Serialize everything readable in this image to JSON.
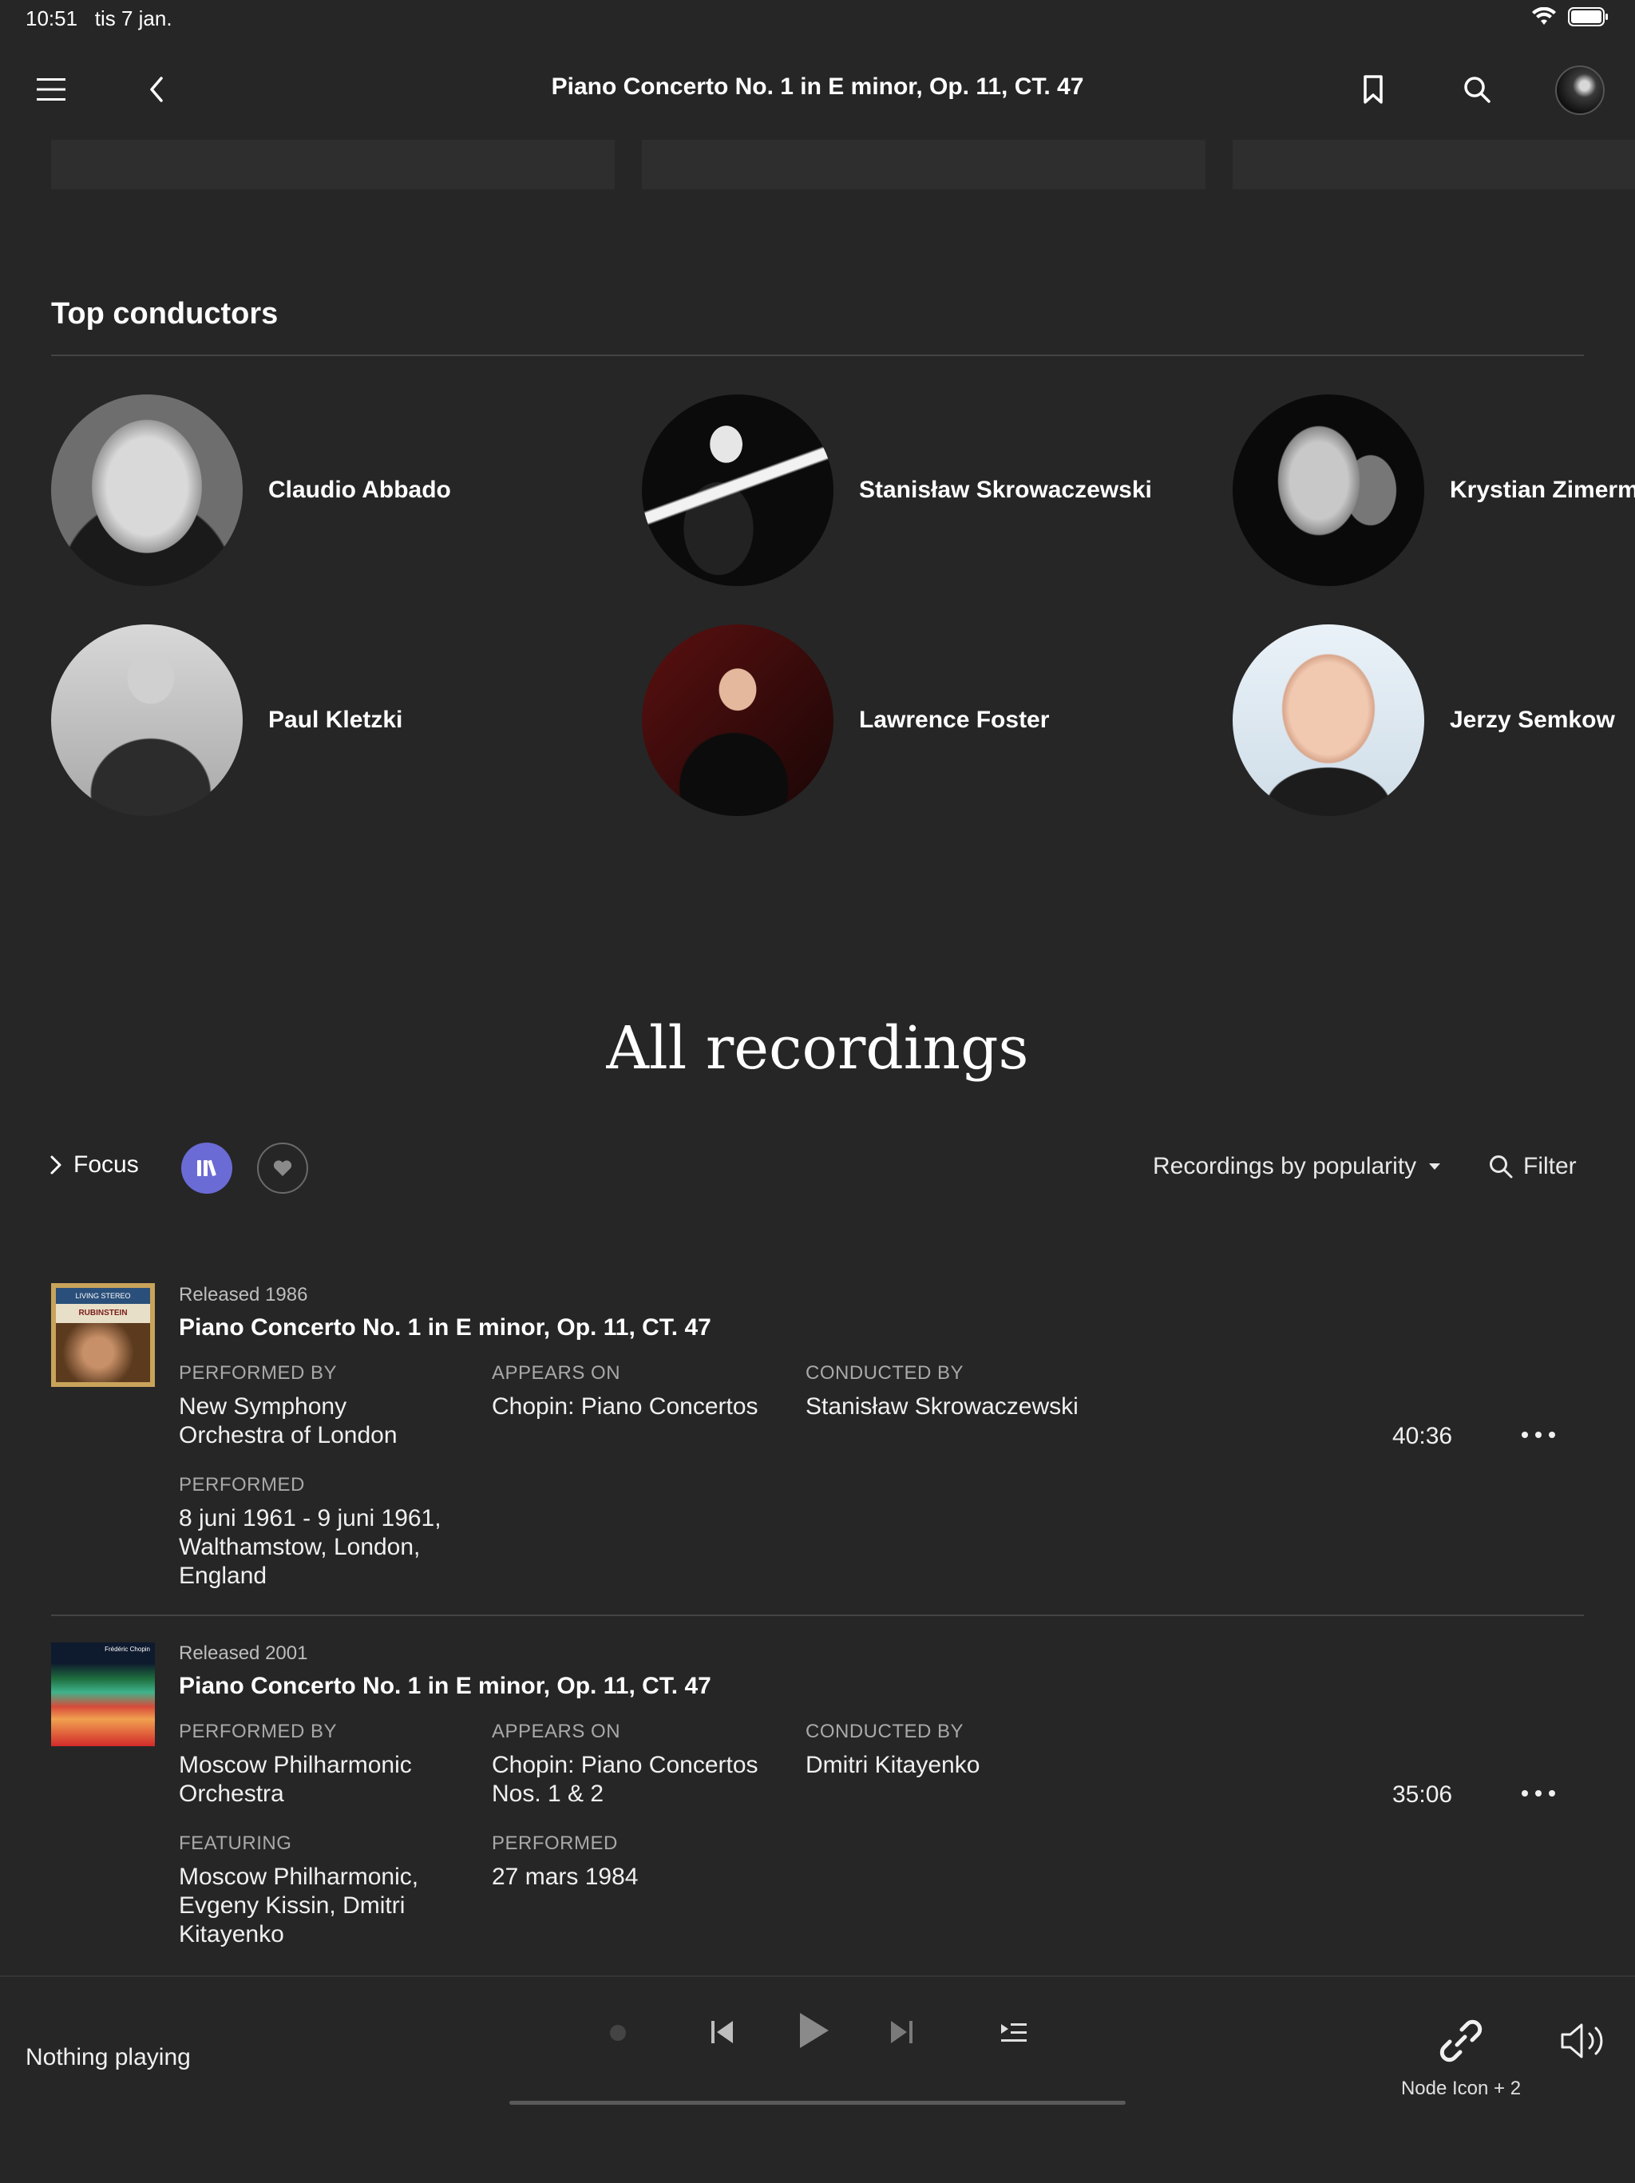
{
  "status_bar": {
    "time": "10:51",
    "date": "tis 7 jan."
  },
  "nav": {
    "title": "Piano Concerto No. 1 in E minor, Op. 11, CT. 47",
    "menu_icon": "hamburger-icon",
    "back_icon": "chevron-left-icon",
    "bookmark_icon": "bookmark-icon",
    "search_icon": "search-icon",
    "avatar_icon": "profile-avatar"
  },
  "conductors": {
    "title": "Top conductors",
    "people": [
      {
        "name": "Claudio Abbado"
      },
      {
        "name": "Stanisław Skrowaczewski"
      },
      {
        "name": "Krystian Zimerma"
      },
      {
        "name": "Paul Kletzki"
      },
      {
        "name": "Lawrence Foster"
      },
      {
        "name": "Jerzy Semkow"
      }
    ]
  },
  "recordings": {
    "title": "All recordings",
    "focus_label": "Focus",
    "sort_label": "Recordings by popularity",
    "filter_label": "Filter",
    "accent_color": "#6b6bd6",
    "items": [
      {
        "released": "Released 1986",
        "title": "Piano Concerto No. 1 in E minor, Op. 11, CT. 47",
        "performed_by_label": "PERFORMED BY",
        "performed_by": "New Symphony Orchestra of London",
        "appears_on_label": "APPEARS ON",
        "appears_on": "Chopin: Piano Concertos",
        "conducted_by_label": "CONDUCTED BY",
        "conducted_by": "Stanisław Skrowaczewski",
        "performed_label": "PERFORMED",
        "performed": "8 juni 1961 - 9 juni 1961, Walthamstow, London, England",
        "duration": "40:36",
        "cover_text": "RUBINSTEIN",
        "cover_brand": "LIVING STEREO"
      },
      {
        "released": "Released 2001",
        "title": "Piano Concerto No. 1 in E minor, Op. 11, CT. 47",
        "performed_by_label": "PERFORMED BY",
        "performed_by": "Moscow Philharmonic Orchestra",
        "appears_on_label": "APPEARS ON",
        "appears_on": "Chopin: Piano Concertos Nos. 1 & 2",
        "conducted_by_label": "CONDUCTED BY",
        "conducted_by": "Dmitri Kitayenko",
        "featuring_label": "FEATURING",
        "featuring": "Moscow Philharmonic, Evgeny Kissin, Dmitri Kitayenko",
        "performed_label": "PERFORMED",
        "performed": "27 mars 1984",
        "duration": "35:06",
        "cover_text": "Frédéric Chopin"
      }
    ]
  },
  "player": {
    "status": "Nothing playing",
    "node_label": "Node Icon + 2"
  }
}
